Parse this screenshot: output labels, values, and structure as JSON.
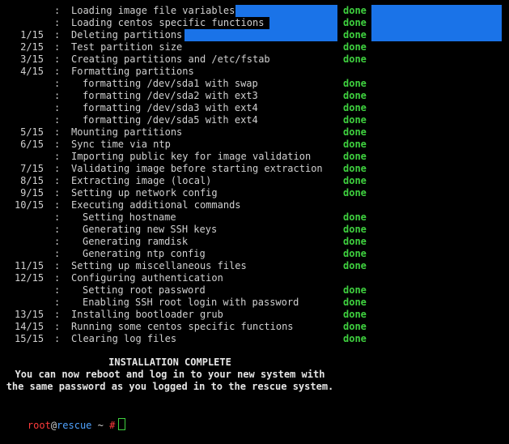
{
  "colors": {
    "background": "#000000",
    "text": "#d0d0d0",
    "done": "#3fd13f",
    "highlight": "#1a73e8",
    "prompt_user": "#ff3b3b",
    "prompt_host": "#4fa3ff"
  },
  "lines": [
    {
      "step": "",
      "message": "Loading image file variables",
      "status": "done",
      "sub": false
    },
    {
      "step": "",
      "message": "Loading centos specific functions",
      "status": "done",
      "sub": false
    },
    {
      "step": "1/15",
      "message": "Deleting partitions",
      "status": "done",
      "sub": false
    },
    {
      "step": "2/15",
      "message": "Test partition size",
      "status": "done",
      "sub": false
    },
    {
      "step": "3/15",
      "message": "Creating partitions and /etc/fstab",
      "status": "done",
      "sub": false
    },
    {
      "step": "4/15",
      "message": "Formatting partitions",
      "status": "",
      "sub": false
    },
    {
      "step": "",
      "message": "formatting /dev/sda1 with swap",
      "status": "done",
      "sub": true
    },
    {
      "step": "",
      "message": "formatting /dev/sda2 with ext3",
      "status": "done",
      "sub": true
    },
    {
      "step": "",
      "message": "formatting /dev/sda3 with ext4",
      "status": "done",
      "sub": true
    },
    {
      "step": "",
      "message": "formatting /dev/sda5 with ext4",
      "status": "done",
      "sub": true
    },
    {
      "step": "5/15",
      "message": "Mounting partitions",
      "status": "done",
      "sub": false
    },
    {
      "step": "6/15",
      "message": "Sync time via ntp",
      "status": "done",
      "sub": false
    },
    {
      "step": "",
      "message": "Importing public key for image validation",
      "status": "done",
      "sub": false
    },
    {
      "step": "7/15",
      "message": "Validating image before starting extraction",
      "status": "done",
      "sub": false
    },
    {
      "step": "8/15",
      "message": "Extracting image (local)",
      "status": "done",
      "sub": false
    },
    {
      "step": "9/15",
      "message": "Setting up network config",
      "status": "done",
      "sub": false
    },
    {
      "step": "10/15",
      "message": "Executing additional commands",
      "status": "",
      "sub": false
    },
    {
      "step": "",
      "message": "Setting hostname",
      "status": "done",
      "sub": true
    },
    {
      "step": "",
      "message": "Generating new SSH keys",
      "status": "done",
      "sub": true
    },
    {
      "step": "",
      "message": "Generating ramdisk",
      "status": "done",
      "sub": true
    },
    {
      "step": "",
      "message": "Generating ntp config",
      "status": "done",
      "sub": true
    },
    {
      "step": "11/15",
      "message": "Setting up miscellaneous files",
      "status": "done",
      "sub": false
    },
    {
      "step": "12/15",
      "message": "Configuring authentication",
      "status": "",
      "sub": false
    },
    {
      "step": "",
      "message": "Setting root password",
      "status": "done",
      "sub": true
    },
    {
      "step": "",
      "message": "Enabling SSH root login with password",
      "status": "done",
      "sub": true
    },
    {
      "step": "13/15",
      "message": "Installing bootloader grub",
      "status": "done",
      "sub": false
    },
    {
      "step": "14/15",
      "message": "Running some centos specific functions",
      "status": "done",
      "sub": false
    },
    {
      "step": "15/15",
      "message": "Clearing log files",
      "status": "done",
      "sub": false
    }
  ],
  "completion": {
    "title": "INSTALLATION COMPLETE",
    "line1": "You can now reboot and log in to your new system with",
    "line2": "the same password as you logged in to the rescue system."
  },
  "prompt": {
    "user": "root",
    "at": "@",
    "host": "rescue",
    "path": " ~ ",
    "symbol": "#"
  }
}
